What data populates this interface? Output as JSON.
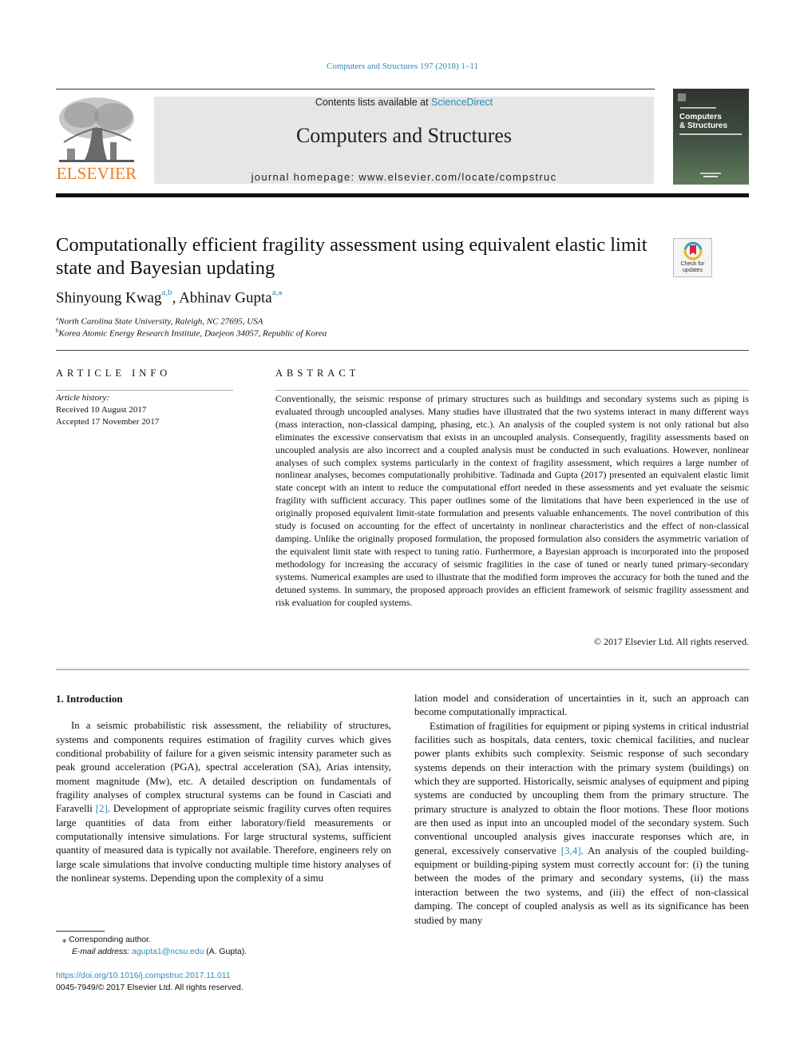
{
  "header": {
    "journal_reference": "Computers and Structures 197 (2018) 1–11",
    "contents_prefix": "Contents lists available at ",
    "contents_link": "ScienceDirect",
    "journal_title": "Computers and Structures",
    "homepage": "journal homepage: www.elsevier.com/locate/compstruc",
    "publisher_logo_text": "ELSEVIER",
    "cover": {
      "title_line1": "Computers",
      "title_line2": "& Structures"
    }
  },
  "article": {
    "title": "Computationally efficient fragility assessment using equivalent elastic limit state and Bayesian updating",
    "check_updates_label_1": "Check for",
    "check_updates_label_2": "updates",
    "authors": [
      {
        "name": "Shinyoung Kwag",
        "affil": "a,b"
      },
      {
        "name": "Abhinav Gupta",
        "affil": "a,⁎"
      }
    ],
    "author_separator": ", ",
    "affiliations": [
      {
        "key": "a",
        "text": "North Carolina State University, Raleigh, NC 27695, USA"
      },
      {
        "key": "b",
        "text": "Korea Atomic Energy Research Institute, Daejeon 34057, Republic of Korea"
      }
    ]
  },
  "article_info": {
    "heading": "ARTICLE INFO",
    "history_label": "Article history:",
    "received": "Received 10 August 2017",
    "accepted": "Accepted 17 November 2017"
  },
  "abstract": {
    "heading": "ABSTRACT",
    "text": "Conventionally, the seismic response of primary structures such as buildings and secondary systems such as piping is evaluated through uncoupled analyses. Many studies have illustrated that the two systems interact in many different ways (mass interaction, non-classical damping, phasing, etc.). An analysis of the coupled system is not only rational but also eliminates the excessive conservatism that exists in an uncoupled analysis. Consequently, fragility assessments based on uncoupled analysis are also incorrect and a coupled analysis must be conducted in such evaluations. However, nonlinear analyses of such com­plex systems particularly in the context of fragility assessment, which requires a large number of nonlin­ear analyses, becomes computationally prohibitive. Tadinada and Gupta (2017) presented an equivalent elastic limit state concept with an intent to reduce the computational effort needed in these assessments and yet evaluate the seismic fragility with sufficient accuracy. This paper outlines some of the limitations that have been experienced in the use of originally proposed equivalent limit-state formulation and pre­sents valuable enhancements. The novel contribution of this study is focused on accounting for the effect of uncertainty in nonlinear characteristics and the effect of non-classical damping. Unlike the originally proposed formulation, the proposed formulation also considers the asymmetric variation of the equivalent limit state with respect to tuning ratio. Furthermore, a Bayesian approach is incorporated into the pro­posed methodology for increasing the accuracy of seismic fragilities in the case of tuned or nearly tuned primary-secondary systems. Numerical examples are used to illustrate that the modified form improves the accuracy for both the tuned and the detuned systems. In summary, the proposed approach provides an efficient framework of seismic fragility assessment and risk evaluation for coupled systems.",
    "copyright": "© 2017 Elsevier Ltd. All rights reserved."
  },
  "body": {
    "section_title": "1. Introduction",
    "left_p1_a": "In a seismic probabilistic risk assessment, the reliability of structures, systems and components requires estimation of fragi­lity curves which gives conditional probability of failure for a given seismic intensity parameter such as peak ground acceleration (PGA), spectral acceleration (SA), Arias intensity, moment magni­tude (Mw), etc. A detailed description on fundamentals of fragility analyses of complex structural systems can be found in Casciati and Faravelli ",
    "left_ref_1": "[2]",
    "left_p1_b": ". Development of appropriate seismic fragility curves often requires large quantities of data from either labora­tory/field measurements or computationally intensive simulations. For large structural systems, sufficient quantity of measured data is typically not available. Therefore, engineers rely on large scale sim­ulations that involve conducting multiple time history analyses of the nonlinear systems. Depending upon the complexity of a simu­",
    "right_p1": "lation model and consideration of uncertainties in it, such an approach can become computationally impractical.",
    "right_p2_a": "Estimation of fragilities for equipment or piping systems in crit­ical industrial facilities such as hospitals, data centers, toxic chem­ical facilities, and nuclear power plants exhibits such complexity. Seismic response of such secondary systems depends on their interaction with the primary system (buildings) on which they are supported. Historically, seismic analyses of equipment and pip­ing systems are conducted by uncoupling them from the primary structure. The primary structure is analyzed to obtain the floor motions. These floor motions are then used as input into an uncou­pled model of the secondary system. Such conventional uncoupled analysis gives inaccurate responses which are, in general, exces­sively conservative ",
    "right_ref_1": "[3,4]",
    "right_p2_b": ". An analysis of the coupled building-equipment or building-piping system must correctly account for: (i) the tuning between the modes of the primary and secondary systems, (ii) the mass interaction between the two systems, and (iii) the effect of non-classical damping. The concept of coupled analysis as well as its significance has been studied by many"
  },
  "footnotes": {
    "marker": "⁎",
    "corresponding": "Corresponding author.",
    "email_label": "E-mail address: ",
    "email": "agupta1@ncsu.edu",
    "email_suffix": " (A. Gupta).",
    "doi": "https://doi.org/10.1016/j.compstruc.2017.11.011",
    "issn": "0045-7949/© 2017 Elsevier Ltd. All rights reserved."
  },
  "colors": {
    "link": "#2a8bb8",
    "elsevier_orange": "#f07a19",
    "masthead_bg": "#e6e6e6"
  }
}
